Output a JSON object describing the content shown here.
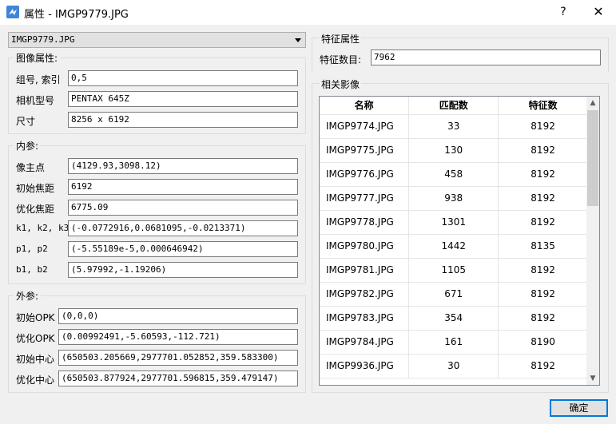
{
  "window": {
    "title": "属性 - IMGP9779.JPG",
    "help": "?",
    "close": "✕"
  },
  "image_select": {
    "value": "IMGP9779.JPG"
  },
  "image_props": {
    "title": "图像属性:",
    "rows": [
      {
        "label": "组号, 索引",
        "value": "0,5"
      },
      {
        "label": "相机型号",
        "value": "PENTAX 645Z"
      },
      {
        "label": "尺寸",
        "value": "8256 x 6192"
      }
    ]
  },
  "intrinsics": {
    "title": "内参:",
    "rows": [
      {
        "label": "像主点",
        "value": "(4129.93,3098.12)"
      },
      {
        "label": "初始焦距",
        "value": "6192"
      },
      {
        "label": "优化焦距",
        "value": "6775.09"
      },
      {
        "label": "k1, k2, k3",
        "value": "(-0.0772916,0.0681095,-0.0213371)"
      },
      {
        "label": "p1, p2",
        "value": "(-5.55189e-5,0.000646942)"
      },
      {
        "label": "b1, b2",
        "value": "(5.97992,-1.19206)"
      }
    ]
  },
  "extrinsics": {
    "title": "外参:",
    "rows": [
      {
        "label": "初始OPK",
        "value": "(0,0,0)"
      },
      {
        "label": "优化OPK",
        "value": "(0.00992491,-5.60593,-112.721)"
      },
      {
        "label": "初始中心",
        "value": "(650503.205669,2977701.052852,359.583300)"
      },
      {
        "label": "优化中心",
        "value": "(650503.877924,2977701.596815,359.479147)"
      }
    ]
  },
  "features": {
    "title": "特征属性",
    "count_label": "特征数目:",
    "count_value": "7962"
  },
  "related": {
    "title": "相关影像",
    "headers": [
      "名称",
      "匹配数",
      "特征数"
    ],
    "rows": [
      [
        "IMGP9774.JPG",
        "33",
        "8192"
      ],
      [
        "IMGP9775.JPG",
        "130",
        "8192"
      ],
      [
        "IMGP9776.JPG",
        "458",
        "8192"
      ],
      [
        "IMGP9777.JPG",
        "938",
        "8192"
      ],
      [
        "IMGP9778.JPG",
        "1301",
        "8192"
      ],
      [
        "IMGP9780.JPG",
        "1442",
        "8135"
      ],
      [
        "IMGP9781.JPG",
        "1105",
        "8192"
      ],
      [
        "IMGP9782.JPG",
        "671",
        "8192"
      ],
      [
        "IMGP9783.JPG",
        "354",
        "8192"
      ],
      [
        "IMGP9784.JPG",
        "161",
        "8190"
      ],
      [
        "IMGP9936.JPG",
        "30",
        "8192"
      ]
    ]
  },
  "ok_button": "确定"
}
